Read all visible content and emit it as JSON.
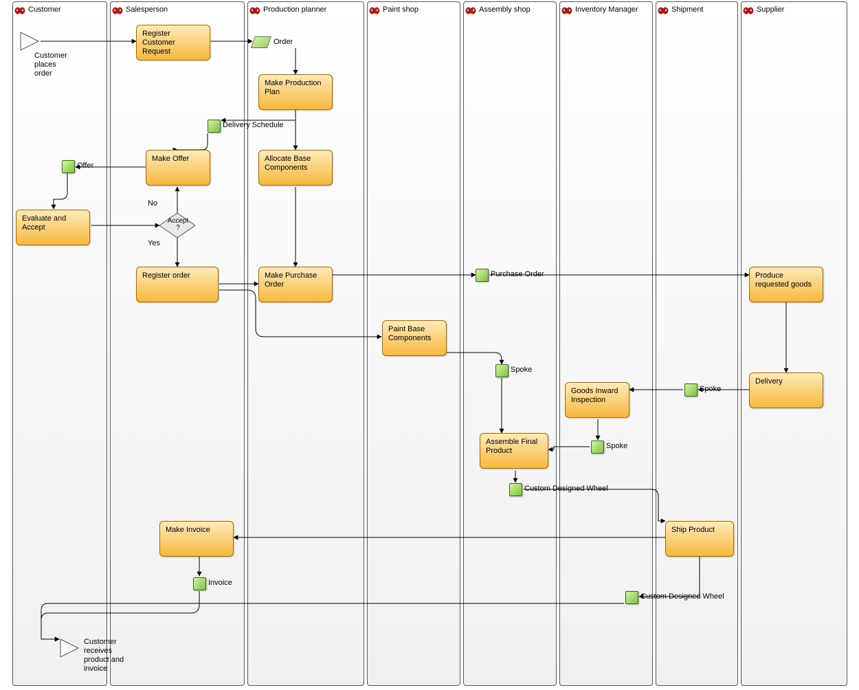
{
  "lanes": {
    "customer": "Customer",
    "salesperson": "Salesperson",
    "planner": "Production planner",
    "paint": "Paint shop",
    "assembly": "Assembly shop",
    "inventory": "Inventory Manager",
    "shipment": "Shipment",
    "supplier": "Supplier"
  },
  "activities": {
    "registerReq": "Register Customer Request",
    "makePlan": "Make Production Plan",
    "allocate": "Allocate Base Components",
    "makeOffer": "Make Offer",
    "evaluate": "Evaluate and Accept",
    "registerOrder": "Register order",
    "makePO": "Make Purchase Order",
    "produceGoods": "Produce requested goods",
    "paintBase": "Paint Base Components",
    "delivery": "Delivery",
    "goodsInward": "Goods Inward Inspection",
    "assembleFinal": "Assemble Final Product",
    "shipProduct": "Ship Product",
    "makeInvoice": "Make Invoice"
  },
  "events": {
    "start": "Customer places order",
    "end": "Customer receives product and invoice"
  },
  "dataobjects": {
    "order": "Order",
    "deliverySchedule": "Delivery Schedule",
    "offer": "Offer",
    "purchaseOrder": "Purchase Order",
    "spoke1": "Spoke",
    "spoke2": "Spoke",
    "spoke3": "Spoke",
    "wheel1": "Custom Designed Wheel",
    "invoice": "Invoice",
    "wheel2": "Custom Designed Wheel"
  },
  "decision": {
    "accept": "Accept ?",
    "no": "No",
    "yes": "Yes"
  }
}
